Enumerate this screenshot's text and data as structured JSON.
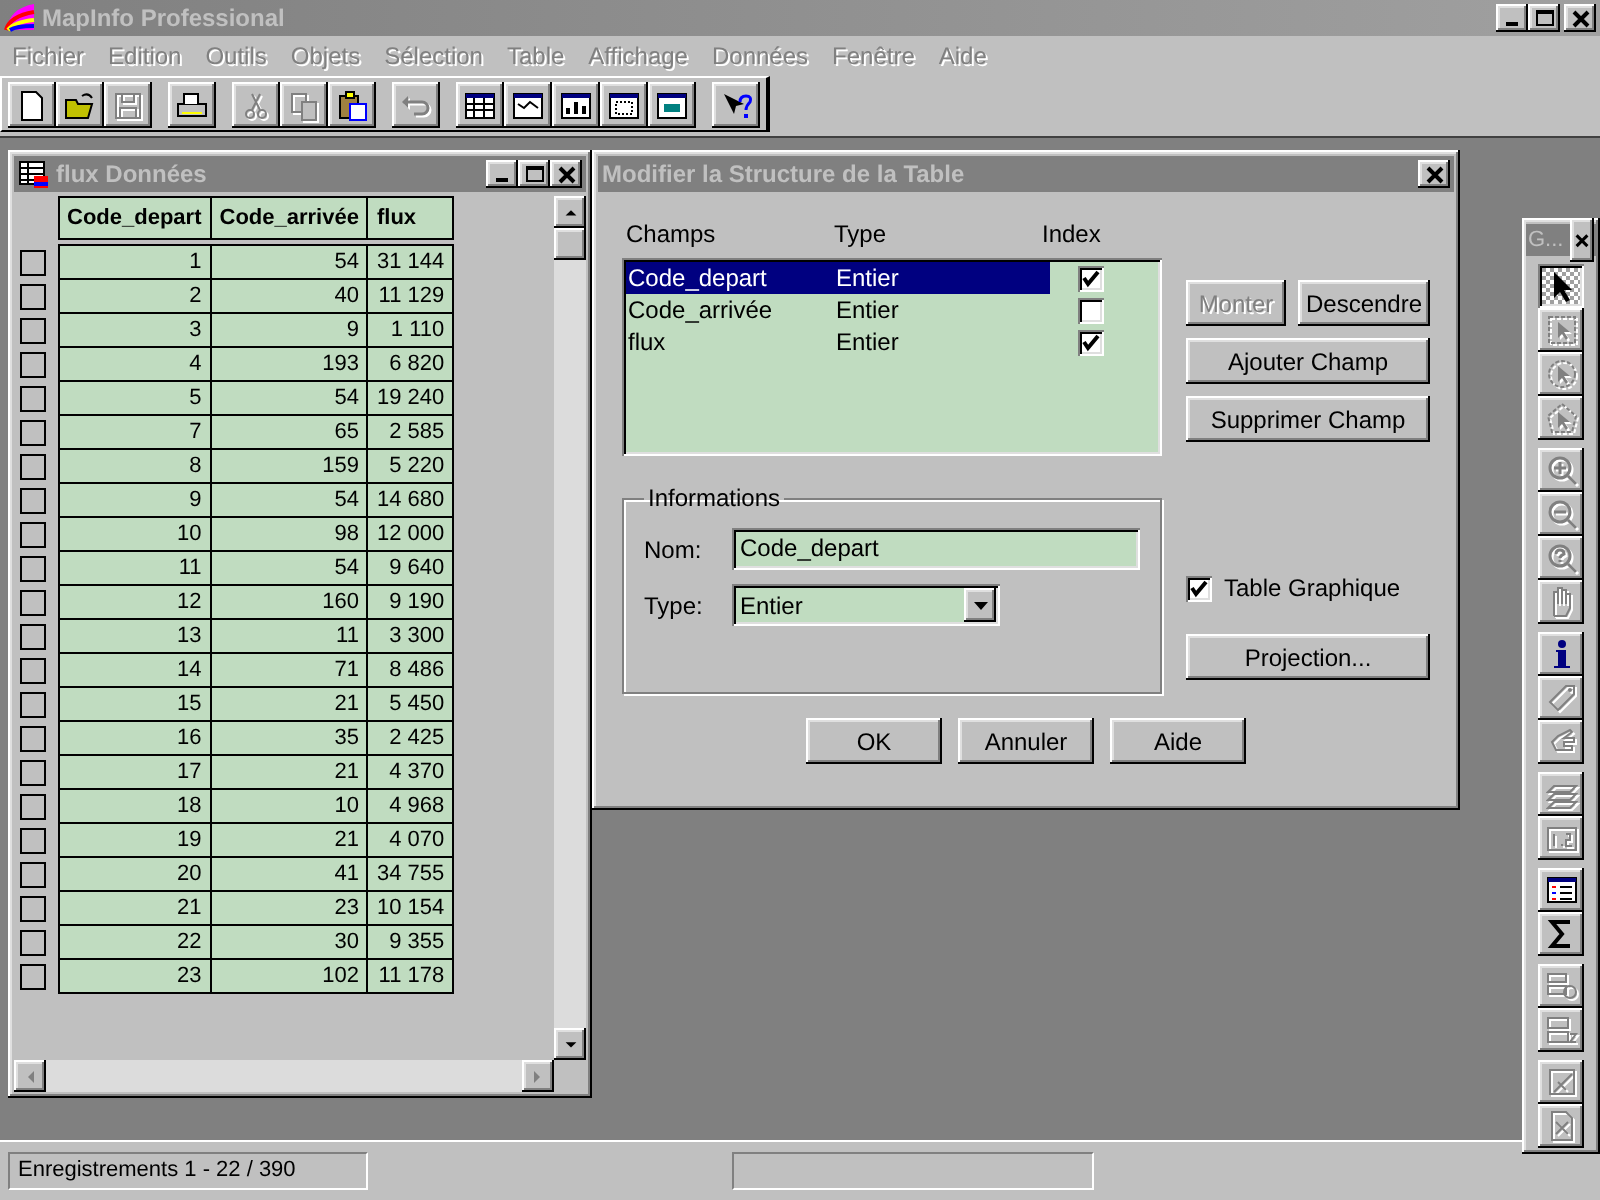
{
  "window": {
    "title": "MapInfo Professional"
  },
  "menu": [
    {
      "label": "Fichier"
    },
    {
      "label": "Edition"
    },
    {
      "label": "Outils"
    },
    {
      "label": "Objets"
    },
    {
      "label": "Sélection"
    },
    {
      "label": "Table"
    },
    {
      "label": "Affichage"
    },
    {
      "label": "Données"
    },
    {
      "label": "Fenêtre"
    },
    {
      "label": "Aide"
    }
  ],
  "toolbar": [
    [
      {
        "kind": "new",
        "disabled": false
      },
      {
        "kind": "open",
        "disabled": false
      },
      {
        "kind": "save",
        "disabled": true
      }
    ],
    [
      {
        "kind": "print",
        "disabled": false
      }
    ],
    [
      {
        "kind": "cut",
        "disabled": true
      },
      {
        "kind": "copy",
        "disabled": true
      },
      {
        "kind": "paste",
        "disabled": false
      }
    ],
    [
      {
        "kind": "undo",
        "disabled": true
      }
    ],
    [
      {
        "kind": "browser",
        "disabled": false
      },
      {
        "kind": "map",
        "disabled": false
      },
      {
        "kind": "graph",
        "disabled": false
      },
      {
        "kind": "layout",
        "disabled": false
      },
      {
        "kind": "redistrict",
        "disabled": false
      }
    ],
    [
      {
        "kind": "help",
        "disabled": false
      }
    ]
  ],
  "browser": {
    "title": "flux Données",
    "columns": [
      "Code_depart",
      "Code_arrivée",
      "flux"
    ],
    "rows": [
      {
        "selected": false,
        "cells": [
          "1",
          "54",
          "31 144"
        ]
      },
      {
        "selected": false,
        "cells": [
          "2",
          "40",
          "11 129"
        ]
      },
      {
        "selected": false,
        "cells": [
          "3",
          "9",
          "1 110"
        ]
      },
      {
        "selected": false,
        "cells": [
          "4",
          "193",
          "6 820"
        ]
      },
      {
        "selected": false,
        "cells": [
          "5",
          "54",
          "19 240"
        ]
      },
      {
        "selected": false,
        "cells": [
          "7",
          "65",
          "2 585"
        ]
      },
      {
        "selected": false,
        "cells": [
          "8",
          "159",
          "5 220"
        ]
      },
      {
        "selected": false,
        "cells": [
          "9",
          "54",
          "14 680"
        ]
      },
      {
        "selected": false,
        "cells": [
          "10",
          "98",
          "12 000"
        ]
      },
      {
        "selected": false,
        "cells": [
          "11",
          "54",
          "9 640"
        ]
      },
      {
        "selected": false,
        "cells": [
          "12",
          "160",
          "9 190"
        ]
      },
      {
        "selected": false,
        "cells": [
          "13",
          "11",
          "3 300"
        ]
      },
      {
        "selected": false,
        "cells": [
          "14",
          "71",
          "8 486"
        ]
      },
      {
        "selected": false,
        "cells": [
          "15",
          "21",
          "5 450"
        ]
      },
      {
        "selected": false,
        "cells": [
          "16",
          "35",
          "2 425"
        ]
      },
      {
        "selected": false,
        "cells": [
          "17",
          "21",
          "4 370"
        ]
      },
      {
        "selected": false,
        "cells": [
          "18",
          "10",
          "4 968"
        ]
      },
      {
        "selected": false,
        "cells": [
          "19",
          "21",
          "4 070"
        ]
      },
      {
        "selected": false,
        "cells": [
          "20",
          "41",
          "34 755"
        ]
      },
      {
        "selected": false,
        "cells": [
          "21",
          "23",
          "10 154"
        ]
      },
      {
        "selected": false,
        "cells": [
          "22",
          "30",
          "9 355"
        ]
      },
      {
        "selected": false,
        "cells": [
          "23",
          "102",
          "11 178"
        ]
      }
    ]
  },
  "dialog": {
    "title": "Modifier la Structure de la Table",
    "list_headers": [
      "Champs",
      "Type",
      "Index"
    ],
    "fields": [
      {
        "name": "Code_depart",
        "type": "Entier",
        "index": true,
        "selected": true
      },
      {
        "name": "Code_arrivée",
        "type": "Entier",
        "index": false,
        "selected": false
      },
      {
        "name": "flux",
        "type": "Entier",
        "index": true,
        "selected": false
      }
    ],
    "side_buttons": [
      {
        "label": "Monter",
        "disabled": true
      },
      {
        "label": "Descendre",
        "disabled": false
      },
      {
        "label": "Ajouter Champ",
        "disabled": false
      },
      {
        "label": "Supprimer Champ",
        "disabled": false
      }
    ],
    "group_title": "Informations",
    "name_label": "Nom:",
    "name_value": "Code_depart",
    "type_label": "Type:",
    "type_value": "Entier",
    "graphic_table": {
      "label": "Table Graphique",
      "checked": true
    },
    "projection_button": "Projection...",
    "buttons": [
      "OK",
      "Annuler",
      "Aide"
    ]
  },
  "palette": {
    "title": "G...",
    "tools": [
      [
        {
          "kind": "select",
          "selected": true,
          "disabled": false
        },
        {
          "kind": "marquee",
          "selected": false,
          "disabled": true
        },
        {
          "kind": "radius",
          "selected": false,
          "disabled": true
        },
        {
          "kind": "boundary",
          "selected": false,
          "disabled": true
        }
      ],
      [
        {
          "kind": "zoom-in",
          "selected": false,
          "disabled": true
        },
        {
          "kind": "zoom-out",
          "selected": false,
          "disabled": true
        },
        {
          "kind": "change-view",
          "selected": false,
          "disabled": true
        },
        {
          "kind": "grabber",
          "selected": false,
          "disabled": true
        }
      ],
      [
        {
          "kind": "info",
          "selected": false,
          "disabled": false
        },
        {
          "kind": "label",
          "selected": false,
          "disabled": true
        },
        {
          "kind": "drag",
          "selected": false,
          "disabled": true
        }
      ],
      [
        {
          "kind": "layers",
          "selected": false,
          "disabled": true
        },
        {
          "kind": "legend",
          "selected": false,
          "disabled": true
        }
      ],
      [
        {
          "kind": "statistics",
          "selected": false,
          "disabled": false
        },
        {
          "kind": "sum",
          "selected": false,
          "disabled": false
        }
      ],
      [
        {
          "kind": "shapes",
          "selected": false,
          "disabled": true
        },
        {
          "kind": "boxes",
          "selected": false,
          "disabled": true
        }
      ],
      [
        {
          "kind": "reshape",
          "selected": false,
          "disabled": true
        },
        {
          "kind": "clip",
          "selected": false,
          "disabled": true
        }
      ]
    ]
  },
  "status_bar": {
    "records": "Enregistrements 1 - 22 / 390"
  }
}
